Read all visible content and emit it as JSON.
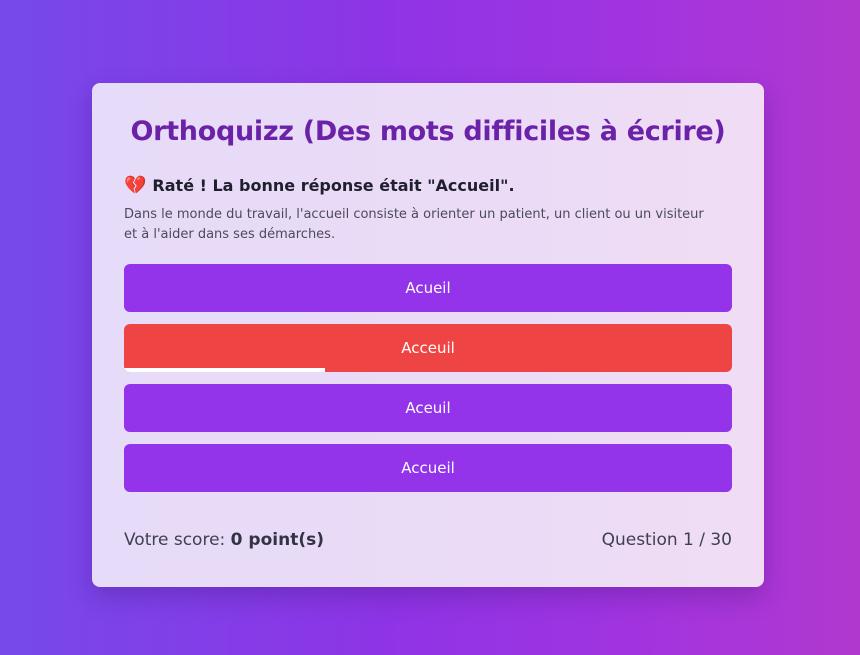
{
  "quiz": {
    "title": "Orthoquizz (Des mots difficiles à écrire)"
  },
  "feedback": {
    "icon": "broken-heart-icon",
    "message": "Raté ! La bonne réponse était \"Accueil\".",
    "explanation": "Dans le monde du travail, l'accueil consiste à orienter un patient, un client ou un visiteur et à l'aider dans ses démarches."
  },
  "answers": [
    {
      "label": "Acueil",
      "state": "default"
    },
    {
      "label": "Acceuil",
      "state": "wrong"
    },
    {
      "label": "Aceuil",
      "state": "default"
    },
    {
      "label": "Accueil",
      "state": "default"
    }
  ],
  "timer": {
    "remaining_fraction": 0.33
  },
  "colors": {
    "accent": "#9333ea",
    "wrong": "#ef4444",
    "title": "#6b21a8"
  },
  "score": {
    "label": "Votre score:",
    "value": "0 point(s)"
  },
  "progress": {
    "text": "Question 1 / 30"
  }
}
